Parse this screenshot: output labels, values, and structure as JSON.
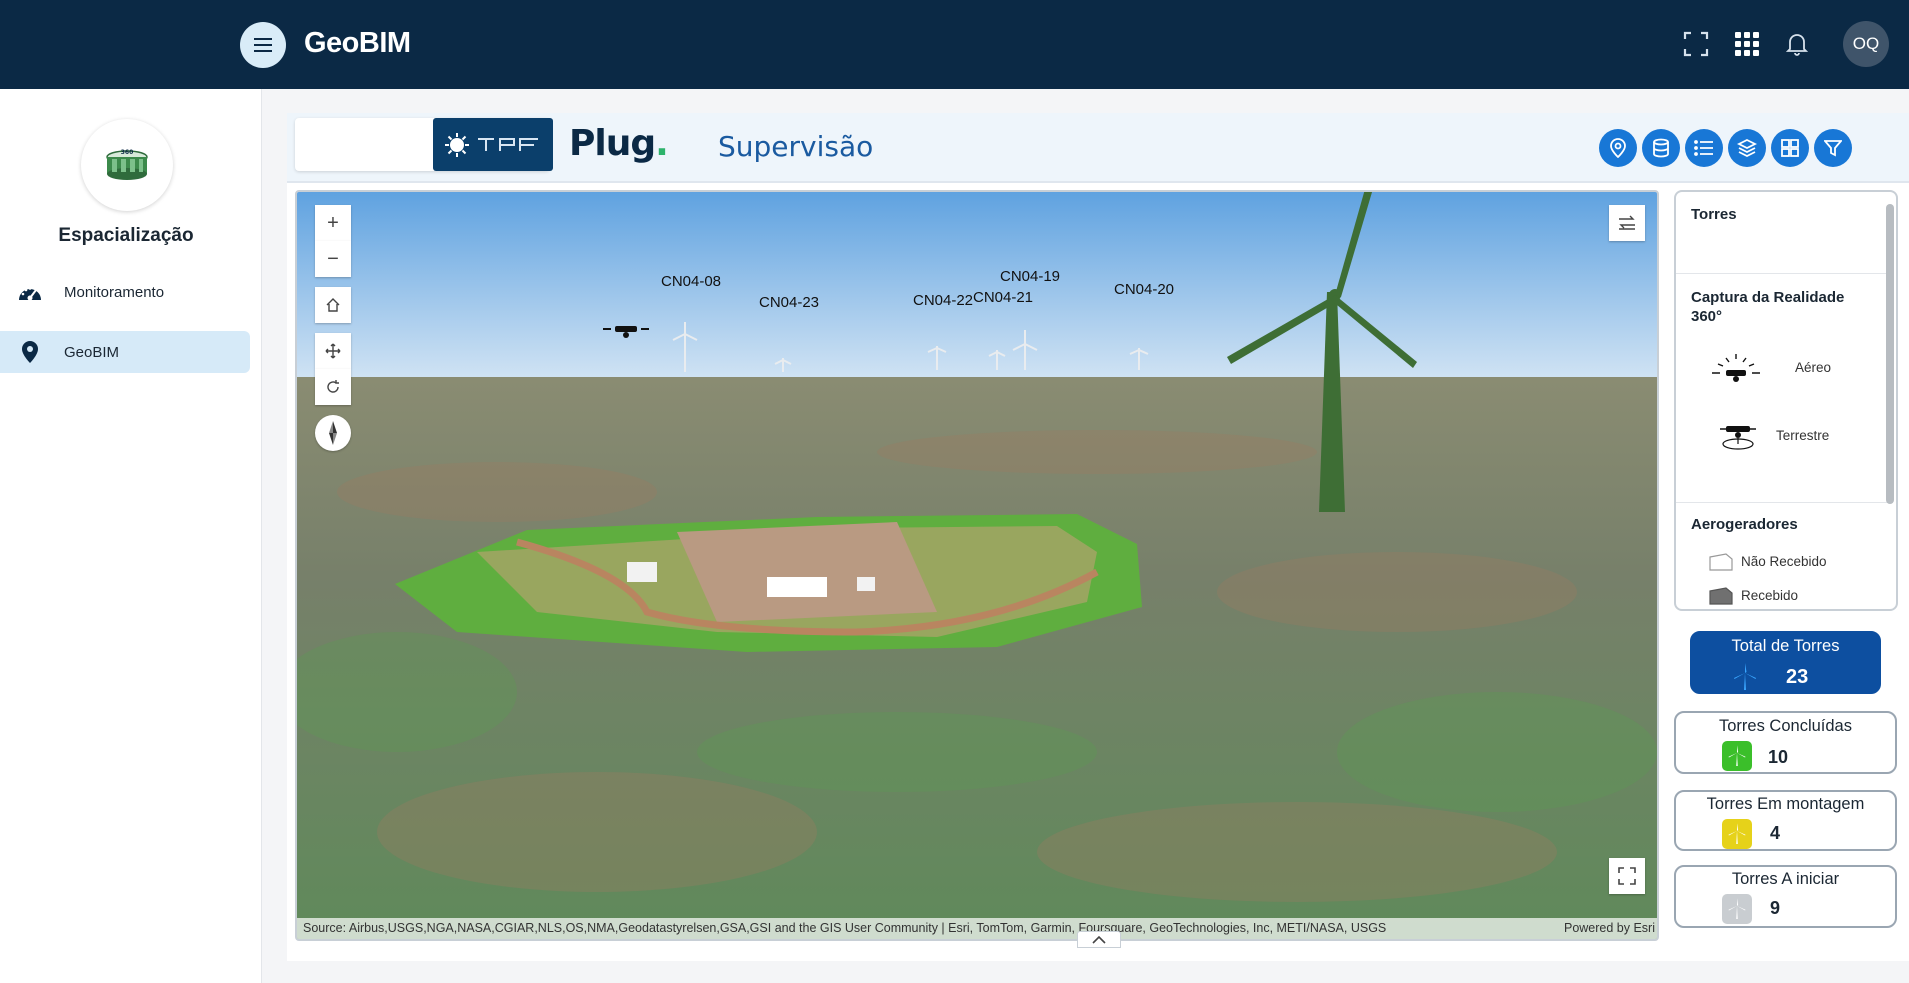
{
  "topbar": {
    "app_title": "GeoBIM",
    "avatar_initials": "OQ",
    "icons": [
      "menu-icon",
      "fullscreen-icon",
      "apps-grid-icon",
      "bell-icon"
    ]
  },
  "sidebar": {
    "title": "Espacialização",
    "items": [
      {
        "label": "Monitoramento",
        "icon": "dashboard-gauge-icon",
        "active": false
      },
      {
        "label": "GeoBIM",
        "icon": "map-pin-icon",
        "active": true
      }
    ]
  },
  "header": {
    "plug_logo": "Plug",
    "page_title": "Supervisão",
    "toolbar_icons": [
      "location-pin-icon",
      "database-icon",
      "list-icon",
      "layers-icon",
      "grid-icon",
      "filter-icon"
    ],
    "accent": "#1877d6"
  },
  "map": {
    "tower_labels": [
      "CN04-08",
      "CN04-23",
      "CN04-22",
      "CN04-21",
      "CN04-19",
      "CN04-20"
    ],
    "attribution": "Source: Airbus,USGS,NGA,NASA,CGIAR,NLS,OS,NMA,Geodatastyrelsen,GSA,GSI and the GIS User Community | Esri, TomTom, Garmin, Foursquare, GeoTechnologies, Inc, METI/NASA, USGS",
    "powered_by": "Powered by Esri",
    "controls": [
      "zoom-in",
      "zoom-out",
      "home",
      "pan",
      "rotate",
      "compass",
      "swap",
      "fullscreen"
    ]
  },
  "legend": {
    "torres_title": "Torres",
    "captura_title": "Captura da Realidade 360°",
    "captura_items": [
      "Aéreo",
      "Terrestre"
    ],
    "aerogeradores_title": "Aerogeradores",
    "aerogeradores_items": [
      "Não Recebido",
      "Recebido"
    ]
  },
  "stats": {
    "total": {
      "label": "Total de Torres",
      "value": "23"
    },
    "concluidas": {
      "label": "Torres Concluídas",
      "value": "10",
      "color": "#3bbf2a"
    },
    "montagem": {
      "label": "Torres Em montagem",
      "value": "4",
      "color": "#e6d21a"
    },
    "iniciar": {
      "label": "Torres A iniciar",
      "value": "9",
      "color": "#c9cdd1"
    }
  }
}
